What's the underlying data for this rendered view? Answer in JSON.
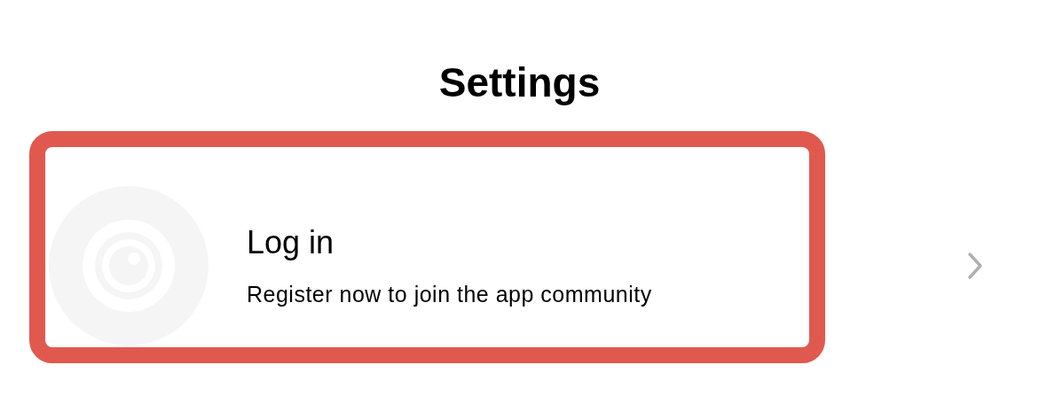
{
  "title": "Settings",
  "account_row": {
    "title": "Log in",
    "subtitle": "Register now to join the app community",
    "highlighted": true
  }
}
